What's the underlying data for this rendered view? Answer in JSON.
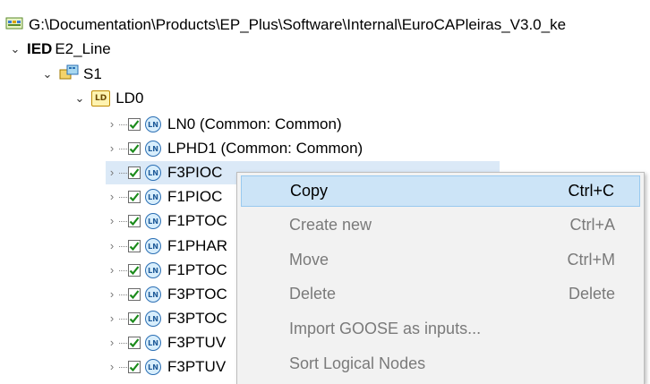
{
  "path": {
    "text": "G:\\Documentation\\Products\\EP_Plus\\Software\\Internal\\EuroCAPleiras_V3.0_ke"
  },
  "tree": {
    "ied": {
      "icon_text": "IED",
      "label": "E2_Line"
    },
    "server": {
      "label": "S1"
    },
    "ld": {
      "icon_text": "LD",
      "label": "LD0"
    },
    "ln_icon_text": "LN",
    "nodes": [
      {
        "label": "LN0 (Common: Common)"
      },
      {
        "label": "LPHD1 (Common: Common)"
      },
      {
        "label": "F3PIOC"
      },
      {
        "label": "F1PIOC"
      },
      {
        "label": "F1PTOC"
      },
      {
        "label": "F1PHAR"
      },
      {
        "label": "F1PTOC"
      },
      {
        "label": "F3PTOC"
      },
      {
        "label": "F3PTOC"
      },
      {
        "label": "F3PTUV"
      },
      {
        "label": "F3PTUV"
      }
    ]
  },
  "context_menu": {
    "items": [
      {
        "label": "Copy",
        "shortcut": "Ctrl+C"
      },
      {
        "label": "Create new",
        "shortcut": "Ctrl+A"
      },
      {
        "label": "Move",
        "shortcut": "Ctrl+M"
      },
      {
        "label": "Delete",
        "shortcut": "Delete"
      },
      {
        "label": "Import GOOSE as inputs...",
        "shortcut": ""
      },
      {
        "label": "Sort Logical Nodes",
        "shortcut": ""
      }
    ]
  },
  "colors": {
    "selection": "#dbe9f7",
    "menu_highlight": "#cce4f7",
    "checkmark": "#1a8a1a",
    "disabled_text": "#7a7a7a"
  }
}
